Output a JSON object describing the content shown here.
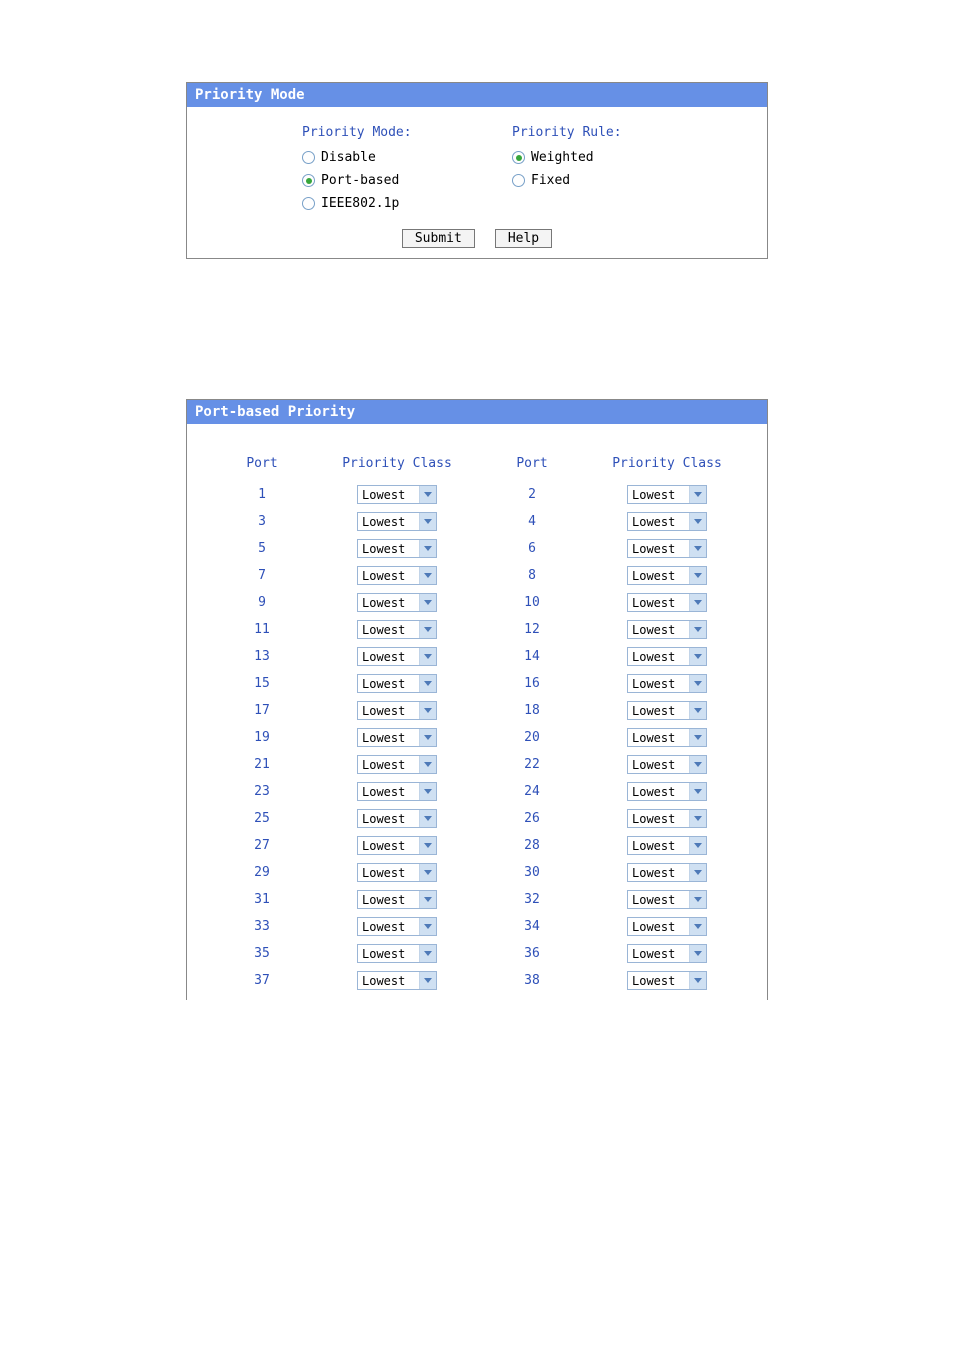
{
  "priority_mode_panel": {
    "title": "Priority Mode",
    "mode_label": "Priority Mode:",
    "rule_label": "Priority Rule:",
    "modes": [
      {
        "label": "Disable",
        "checked": false
      },
      {
        "label": "Port-based",
        "checked": true
      },
      {
        "label": "IEEE802.1p",
        "checked": false
      }
    ],
    "rules": [
      {
        "label": "Weighted",
        "checked": true
      },
      {
        "label": "Fixed",
        "checked": false
      }
    ],
    "submit_label": "Submit",
    "help_label": "Help"
  },
  "port_priority_panel": {
    "title": "Port-based Priority",
    "headers": {
      "port": "Port",
      "priority_class": "Priority Class"
    },
    "rows": [
      {
        "left_port": "1",
        "left_class": "Lowest",
        "right_port": "2",
        "right_class": "Lowest"
      },
      {
        "left_port": "3",
        "left_class": "Lowest",
        "right_port": "4",
        "right_class": "Lowest"
      },
      {
        "left_port": "5",
        "left_class": "Lowest",
        "right_port": "6",
        "right_class": "Lowest"
      },
      {
        "left_port": "7",
        "left_class": "Lowest",
        "right_port": "8",
        "right_class": "Lowest"
      },
      {
        "left_port": "9",
        "left_class": "Lowest",
        "right_port": "10",
        "right_class": "Lowest"
      },
      {
        "left_port": "11",
        "left_class": "Lowest",
        "right_port": "12",
        "right_class": "Lowest"
      },
      {
        "left_port": "13",
        "left_class": "Lowest",
        "right_port": "14",
        "right_class": "Lowest"
      },
      {
        "left_port": "15",
        "left_class": "Lowest",
        "right_port": "16",
        "right_class": "Lowest"
      },
      {
        "left_port": "17",
        "left_class": "Lowest",
        "right_port": "18",
        "right_class": "Lowest"
      },
      {
        "left_port": "19",
        "left_class": "Lowest",
        "right_port": "20",
        "right_class": "Lowest"
      },
      {
        "left_port": "21",
        "left_class": "Lowest",
        "right_port": "22",
        "right_class": "Lowest"
      },
      {
        "left_port": "23",
        "left_class": "Lowest",
        "right_port": "24",
        "right_class": "Lowest"
      },
      {
        "left_port": "25",
        "left_class": "Lowest",
        "right_port": "26",
        "right_class": "Lowest"
      },
      {
        "left_port": "27",
        "left_class": "Lowest",
        "right_port": "28",
        "right_class": "Lowest"
      },
      {
        "left_port": "29",
        "left_class": "Lowest",
        "right_port": "30",
        "right_class": "Lowest"
      },
      {
        "left_port": "31",
        "left_class": "Lowest",
        "right_port": "32",
        "right_class": "Lowest"
      },
      {
        "left_port": "33",
        "left_class": "Lowest",
        "right_port": "34",
        "right_class": "Lowest"
      },
      {
        "left_port": "35",
        "left_class": "Lowest",
        "right_port": "36",
        "right_class": "Lowest"
      },
      {
        "left_port": "37",
        "left_class": "Lowest",
        "right_port": "38",
        "right_class": "Lowest"
      }
    ]
  }
}
